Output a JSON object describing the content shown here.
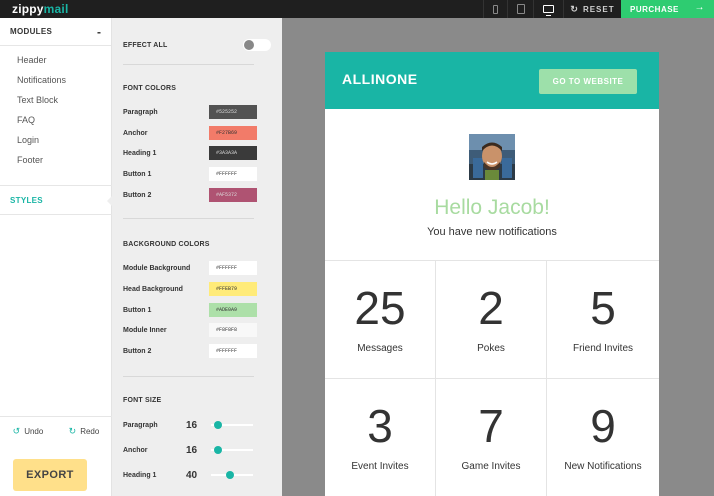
{
  "app": {
    "logo_part1": "zippy",
    "logo_part2": "mail"
  },
  "topbar": {
    "devices": [
      "phone-icon",
      "tablet-icon",
      "desktop-icon"
    ],
    "active_device": "desktop",
    "reset_label": "RESET",
    "purchase_label": "PURCHASE",
    "purchase_color": "#2ECC71"
  },
  "sidebar": {
    "modules_label": "MODULES",
    "collapse_symbol": "-",
    "items": [
      {
        "label": "Header"
      },
      {
        "label": "Notifications"
      },
      {
        "label": "Text Block"
      },
      {
        "label": "FAQ"
      },
      {
        "label": "Login"
      },
      {
        "label": "Footer"
      }
    ],
    "styles_label": "STYLES",
    "undo_label": "Undo",
    "redo_label": "Redo",
    "export_label": "EXPORT"
  },
  "panel": {
    "effect_all_label": "EFFECT ALL",
    "effect_all_on": false,
    "font_colors_title": "FONT COLORS",
    "font_colors": [
      {
        "label": "Paragraph",
        "value": "#525252",
        "bg": "#525252",
        "text_color": "#dddddd"
      },
      {
        "label": "Anchor",
        "value": "#F27B69",
        "bg": "#F27B69",
        "text_color": "#333333"
      },
      {
        "label": "Heading 1",
        "value": "#3A3A3A",
        "bg": "#3A3A3A",
        "text_color": "#dddddd"
      },
      {
        "label": "Button 1",
        "value": "#FFFFFF",
        "bg": "#FFFFFF",
        "text_color": "#333333"
      },
      {
        "label": "Button 2",
        "value": "#AF5372",
        "bg": "#AF5372",
        "text_color": "#dddddd"
      }
    ],
    "background_colors_title": "BACKGROUND COLORS",
    "background_colors": [
      {
        "label": "Module Background",
        "value": "#FFFFFF",
        "bg": "#FFFFFF",
        "text_color": "#333333"
      },
      {
        "label": "Head Background",
        "value": "#FFEB79",
        "bg": "#FFEB79",
        "text_color": "#333333"
      },
      {
        "label": "Button 1",
        "value": "#ADE0A9",
        "bg": "#ADE0A9",
        "text_color": "#333333"
      },
      {
        "label": "Module Inner",
        "value": "#F8F8F8",
        "bg": "#F8F8F8",
        "text_color": "#333333"
      },
      {
        "label": "Button 2",
        "value": "#FFFFFF",
        "bg": "#FFFFFF",
        "text_color": "#333333"
      }
    ],
    "font_size_title": "FONT SIZE",
    "font_sizes": [
      {
        "label": "Paragraph",
        "value": "16",
        "level": 0.1
      },
      {
        "label": "Anchor",
        "value": "16",
        "level": 0.1
      },
      {
        "label": "Heading 1",
        "value": "40",
        "level": 0.45
      }
    ]
  },
  "email": {
    "brand": "ALLINONE",
    "cta": "GO TO WEBSITE",
    "header_color": "#19B5A5",
    "greeting": "Hello Jacob!",
    "subtitle": "You have new notifications",
    "stats": [
      {
        "number": "25",
        "label": "Messages"
      },
      {
        "number": "2",
        "label": "Pokes"
      },
      {
        "number": "5",
        "label": "Friend Invites"
      },
      {
        "number": "3",
        "label": "Event Invites"
      },
      {
        "number": "7",
        "label": "Game Invites"
      },
      {
        "number": "9",
        "label": "New Notifications"
      }
    ]
  }
}
